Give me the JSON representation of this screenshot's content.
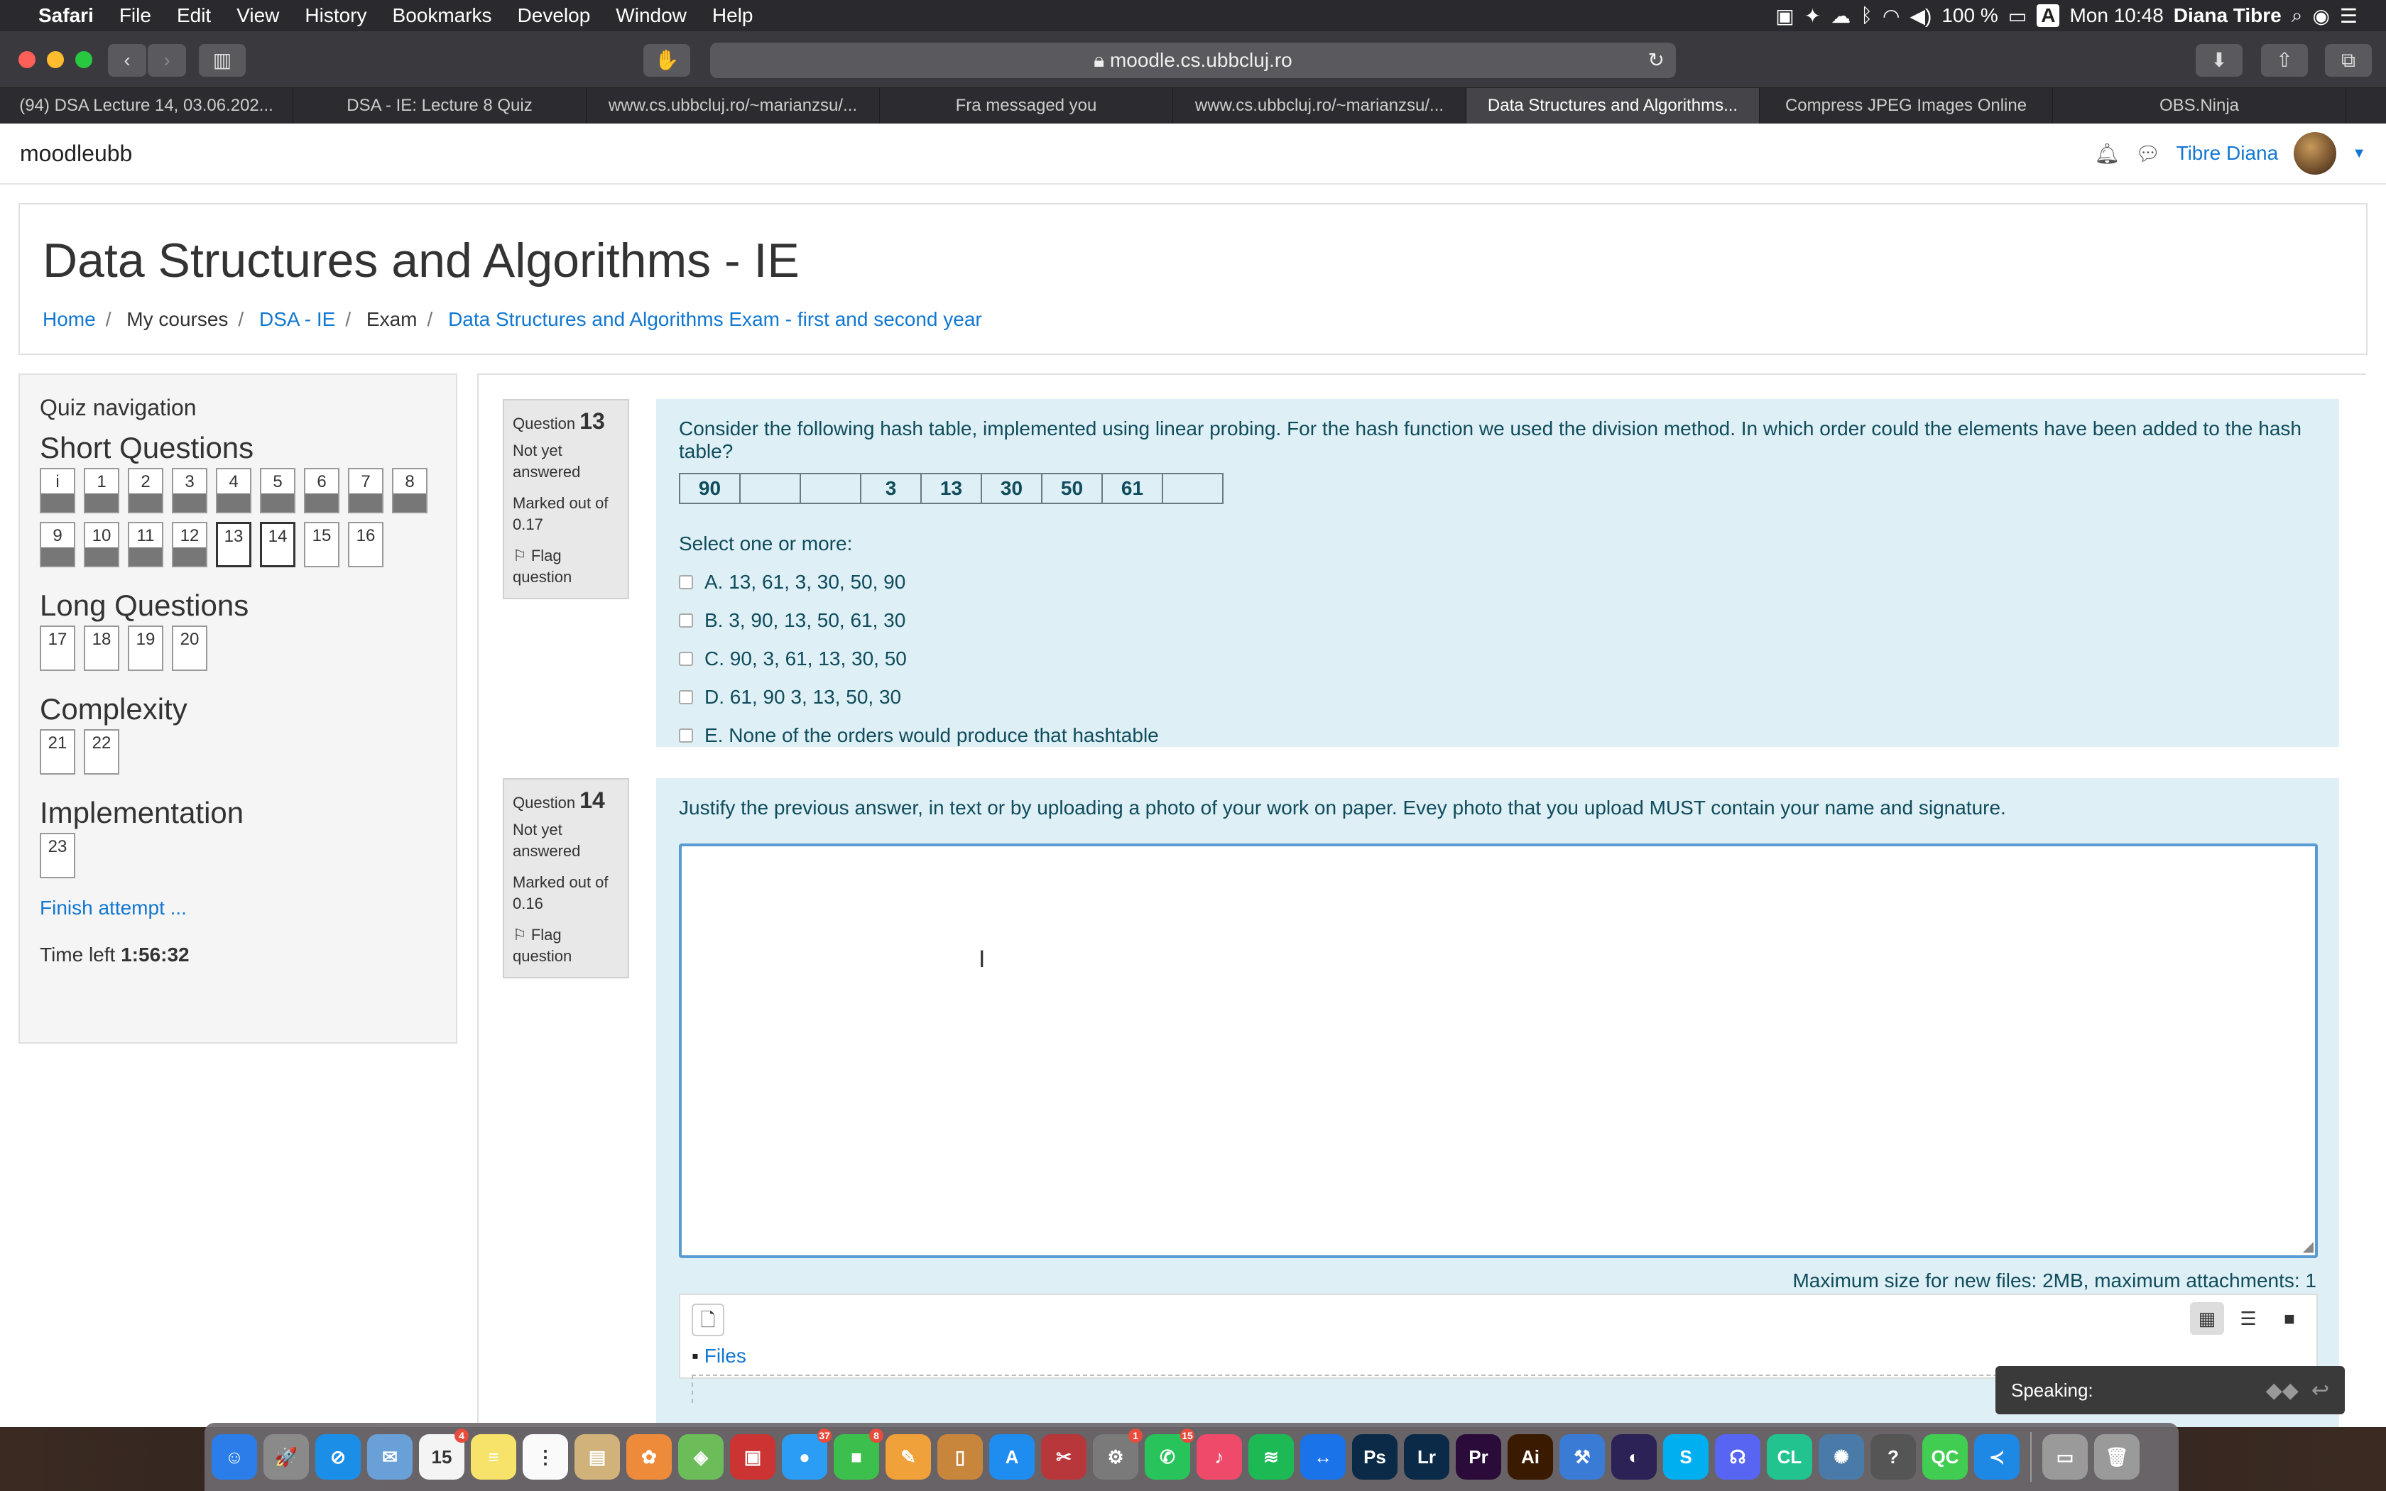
{
  "menubar": {
    "apple": "",
    "items": [
      "Safari",
      "File",
      "Edit",
      "View",
      "History",
      "Bookmarks",
      "Develop",
      "Window",
      "Help"
    ],
    "battery": "100 %",
    "input_source": "A",
    "clock": "Mon 10:48",
    "user": "Diana Tibre"
  },
  "browser": {
    "url": "moodle.cs.ubbcluj.ro",
    "tabs": [
      "(94) DSA Lecture 14, 03.06.202...",
      "DSA - IE: Lecture 8 Quiz",
      "www.cs.ubbcluj.ro/~marianzsu/...",
      "Fra messaged you",
      "www.cs.ubbcluj.ro/~marianzsu/...",
      "Data Structures and Algorithms...",
      "Compress JPEG Images Online",
      "OBS.Ninja"
    ],
    "active_tab": 5
  },
  "navbar": {
    "brand": "moodleubb",
    "user_name": "Tibre Diana"
  },
  "course": {
    "title": "Data Structures and Algorithms - IE",
    "breadcrumb": [
      "Home",
      "My courses",
      "DSA - IE",
      "Exam",
      "Data Structures and Algorithms Exam - first and second year"
    ]
  },
  "quiz_nav": {
    "heading": "Quiz navigation",
    "sections": [
      {
        "title": "Short Questions",
        "buttons": [
          {
            "label": "i",
            "state": "answered"
          },
          {
            "label": "1",
            "state": "answered"
          },
          {
            "label": "2",
            "state": "answered"
          },
          {
            "label": "3",
            "state": "answered"
          },
          {
            "label": "4",
            "state": "answered"
          },
          {
            "label": "5",
            "state": "answered"
          },
          {
            "label": "6",
            "state": "answered"
          },
          {
            "label": "7",
            "state": "answered"
          },
          {
            "label": "8",
            "state": "answered"
          },
          {
            "label": "9",
            "state": "answered"
          },
          {
            "label": "10",
            "state": "answered"
          },
          {
            "label": "11",
            "state": "answered"
          },
          {
            "label": "12",
            "state": "answered"
          },
          {
            "label": "13",
            "state": "current"
          },
          {
            "label": "14",
            "state": "current"
          },
          {
            "label": "15",
            "state": "empty"
          },
          {
            "label": "16",
            "state": "empty"
          }
        ]
      },
      {
        "title": "Long Questions",
        "buttons": [
          {
            "label": "17",
            "state": "empty"
          },
          {
            "label": "18",
            "state": "empty"
          },
          {
            "label": "19",
            "state": "empty"
          },
          {
            "label": "20",
            "state": "empty"
          }
        ]
      },
      {
        "title": "Complexity",
        "buttons": [
          {
            "label": "21",
            "state": "empty"
          },
          {
            "label": "22",
            "state": "empty"
          }
        ]
      },
      {
        "title": "Implementation",
        "buttons": [
          {
            "label": "23",
            "state": "empty"
          }
        ]
      }
    ],
    "finish": "Finish attempt ...",
    "time_label": "Time left",
    "time_value": "1:56:32"
  },
  "q13": {
    "label": "Question",
    "number": "13",
    "status": "Not yet answered",
    "marked": "Marked out of 0.17",
    "flag": "Flag question",
    "text": "Consider the following hash table, implemented using linear probing. For the hash function we used the division method. In which order could the elements have been added to the hash table?",
    "table": [
      "90",
      "",
      "",
      "3",
      "13",
      "30",
      "50",
      "61",
      ""
    ],
    "select_label": "Select one or more:",
    "options": [
      "A. 13, 61, 3, 30, 50, 90",
      "B. 3, 90, 13, 50, 61, 30",
      "C. 90, 3, 61, 13, 30, 50",
      "D. 61, 90 3, 13, 50, 30",
      "E. None of the orders would produce that hashtable"
    ]
  },
  "q14": {
    "label": "Question",
    "number": "14",
    "status": "Not yet answered",
    "marked": "Marked out of 0.16",
    "flag": "Flag question",
    "text": "Justify the previous answer, in text or by uploading a photo of your work on paper. Evey photo that you upload MUST contain your name and signature.",
    "max_size": "Maximum size for new files: 2MB, maximum attachments: 1",
    "files_label": "Files"
  },
  "speaking": {
    "label": "Speaking:"
  },
  "dock": [
    {
      "name": "finder",
      "color": "#2b7de9",
      "glyph": "☺"
    },
    {
      "name": "launchpad",
      "color": "#8a8a8a",
      "glyph": "🚀"
    },
    {
      "name": "safari",
      "color": "#1b8fe8",
      "glyph": "⊘"
    },
    {
      "name": "preview",
      "color": "#6aa0d8",
      "glyph": "✉"
    },
    {
      "name": "calendar",
      "color": "#f4f4f4",
      "glyph": "15",
      "badge": "4"
    },
    {
      "name": "notes",
      "color": "#f7e36a",
      "glyph": "≡"
    },
    {
      "name": "reminders",
      "color": "#fafafa",
      "glyph": "⋮"
    },
    {
      "name": "notes2",
      "color": "#d0b27a",
      "glyph": "▤"
    },
    {
      "name": "photos",
      "color": "#ee8b3a",
      "glyph": "✿"
    },
    {
      "name": "maps",
      "color": "#6cbd5a",
      "glyph": "◈"
    },
    {
      "name": "photobooth",
      "color": "#c33",
      "glyph": "▣"
    },
    {
      "name": "messages",
      "color": "#2b9df4",
      "glyph": "●",
      "badge": "37"
    },
    {
      "name": "facetime",
      "color": "#3cbf4c",
      "glyph": "■",
      "badge": "8"
    },
    {
      "name": "pages",
      "color": "#f1a13a",
      "glyph": "✎"
    },
    {
      "name": "books",
      "color": "#c8863c",
      "glyph": "▯"
    },
    {
      "name": "appstore",
      "color": "#1f8cf0",
      "glyph": "A"
    },
    {
      "name": "photo-editor",
      "color": "#b8373a",
      "glyph": "✂"
    },
    {
      "name": "system-prefs",
      "color": "#7a7a7a",
      "glyph": "⚙",
      "badge": "1"
    },
    {
      "name": "whatsapp",
      "color": "#28c45b",
      "glyph": "✆",
      "badge": "15"
    },
    {
      "name": "music",
      "color": "#f04a6a",
      "glyph": "♪"
    },
    {
      "name": "spotify",
      "color": "#1db954",
      "glyph": "≋"
    },
    {
      "name": "teamviewer",
      "color": "#1a73e8",
      "glyph": "↔"
    },
    {
      "name": "photoshop",
      "color": "#0b2a48",
      "glyph": "Ps"
    },
    {
      "name": "lightroom",
      "color": "#0b2a48",
      "glyph": "Lr"
    },
    {
      "name": "premiere",
      "color": "#2a0b3a",
      "glyph": "Pr"
    },
    {
      "name": "illustrator",
      "color": "#3a1a00",
      "glyph": "Ai"
    },
    {
      "name": "xcode",
      "color": "#3a7bd5",
      "glyph": "⚒"
    },
    {
      "name": "eclipse",
      "color": "#2c2255",
      "glyph": "◐"
    },
    {
      "name": "skype",
      "color": "#00aff0",
      "glyph": "S"
    },
    {
      "name": "discord",
      "color": "#5865f2",
      "glyph": "☊"
    },
    {
      "name": "clion",
      "color": "#22c38e",
      "glyph": "CL"
    },
    {
      "name": "vpn",
      "color": "#4a7aa8",
      "glyph": "✺"
    },
    {
      "name": "help",
      "color": "#555",
      "glyph": "?"
    },
    {
      "name": "qt-creator",
      "color": "#41cd52",
      "glyph": "QC"
    },
    {
      "name": "vscode",
      "color": "#1e88e5",
      "glyph": "≺"
    },
    {
      "name": "downloads",
      "color": "#9a9a9a",
      "glyph": "▭"
    },
    {
      "name": "trash",
      "color": "#9a9a9a",
      "glyph": "🗑"
    }
  ]
}
